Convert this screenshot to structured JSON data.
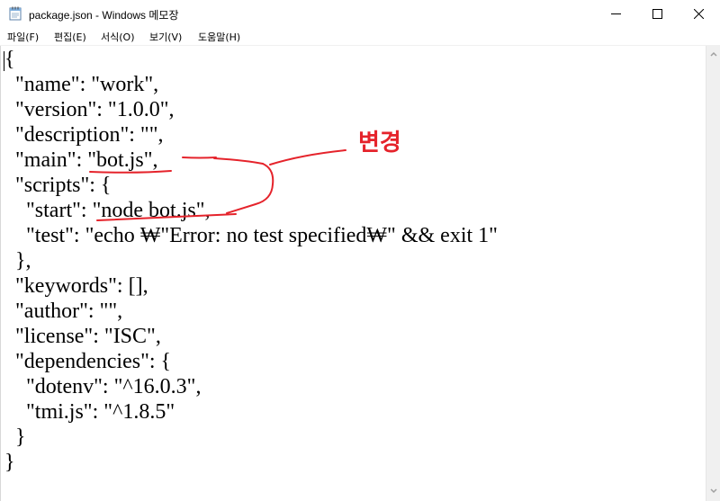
{
  "window": {
    "title": "package.json - Windows 메모장"
  },
  "menu": [
    {
      "label": "파일(F)"
    },
    {
      "label": "편집(E)"
    },
    {
      "label": "서식(O)"
    },
    {
      "label": "보기(V)"
    },
    {
      "label": "도움말(H)"
    }
  ],
  "editor": {
    "lines": [
      "{",
      "  \"name\": \"work\",",
      "  \"version\": \"1.0.0\",",
      "  \"description\": \"\",",
      "  \"main\": \"bot.js\",",
      "  \"scripts\": {",
      "    \"start\": \"node bot.js\",",
      "    \"test\": \"echo ₩\"Error: no test specified₩\" && exit 1\"",
      "  },",
      "  \"keywords\": [],",
      "  \"author\": \"\",",
      "  \"license\": \"ISC\",",
      "  \"dependencies\": {",
      "    \"dotenv\": \"^16.0.3\",",
      "    \"tmi.js\": \"^1.8.5\"",
      "  }",
      "}"
    ]
  },
  "annotation": {
    "label": "변경",
    "color": "#e5232b"
  },
  "icons": {
    "app": "notepad-icon",
    "minimize": "minimize-icon",
    "maximize": "maximize-icon",
    "close": "close-icon"
  }
}
